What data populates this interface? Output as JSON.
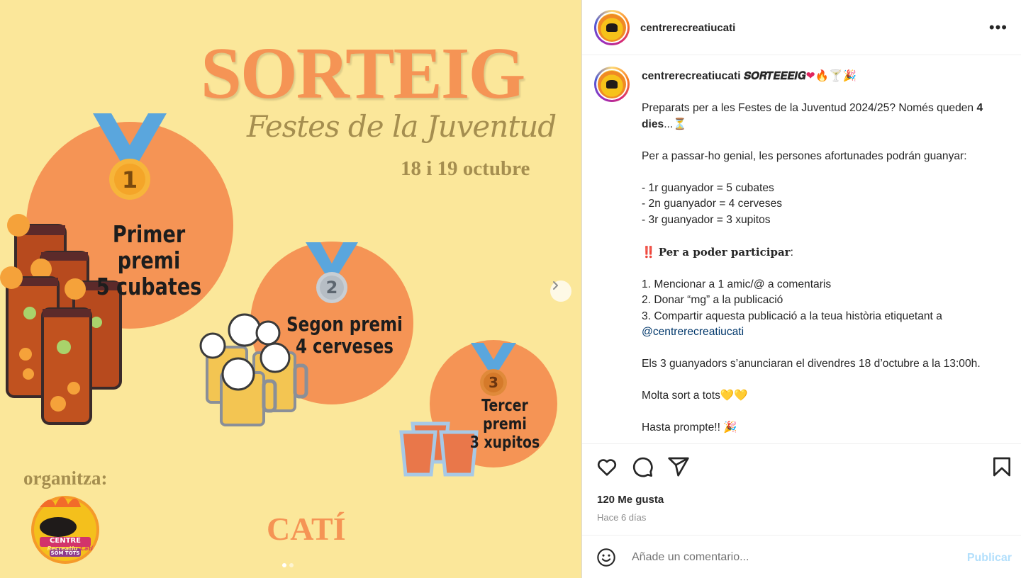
{
  "post_image": {
    "title": "SORTEIG",
    "subtitle": "Festes de la Juventud",
    "dates": "18 i 19 octubre",
    "prizes": [
      {
        "medal": "1",
        "line1": "Primer premi",
        "line2": "5 cubates"
      },
      {
        "medal": "2",
        "line1": "Segon premi",
        "line2": "4 cerveses"
      },
      {
        "medal": "3",
        "line1": "Tercer premi",
        "line2": "3 xupitos"
      }
    ],
    "organizer_label": "organitza:",
    "town": "CATÍ",
    "logo": {
      "line1": "CENTRE",
      "line2": "Recreatiu",
      "line3": "SOM TOTS",
      "line4": "Catí"
    },
    "carousel": {
      "total": 2,
      "current": 1
    }
  },
  "colors": {
    "background": "#fbe79a",
    "orange": "#f59455",
    "olive": "#a58e4f",
    "medal_ribbon": "#5aa6dd"
  },
  "header": {
    "username": "centrerecreatiucati",
    "more_icon": "more-horizontal-icon"
  },
  "caption": {
    "username": "centrerecreatiucati",
    "headline": "𝑺𝑶𝑹𝑻𝑬𝑬𝑬𝑰𝑮",
    "headline_emojis": "❤🔥🍸🎉",
    "line_intro": "Preparats per a les Festes de la Juventud 2024/25? Només queden ",
    "days_bold": "4 dies",
    "line_intro_end": "...⏳",
    "line_genial": "Per a passar-ho genial, les persones afortunades podrán guanyar:",
    "prize_lines": [
      "- 1r guanyador = 5 cubates",
      "- 2n guanyador = 4 cerveses",
      "- 3r guanyador = 3 xupitos"
    ],
    "participate_prefix": "‼️ ",
    "participate_bold": "Per a poder participar",
    "participate_suffix": ":",
    "steps": [
      "1. Mencionar a 1 amic/@ a comentaris",
      "2. Donar “mg” a la publicació",
      "3. Compartir aquesta publicació a la teua història etiquetant a"
    ],
    "mention": "@centrerecreatiucati",
    "announce": "Els 3 guanyadors s’anunciaran el divendres 18 d’octubre a la 13:00h.",
    "luck": "Molta sort a tots💛💛",
    "cut_line": "Hasta prompte!! 🎉"
  },
  "actions": {
    "icons": [
      "heart-icon",
      "comment-icon",
      "share-icon",
      "bookmark-icon"
    ],
    "likes": "120 Me gusta",
    "time": "Hace 6 días"
  },
  "comment_box": {
    "placeholder": "Añade un comentario...",
    "publish": "Publicar",
    "emoji_icon": "emoji-icon"
  }
}
